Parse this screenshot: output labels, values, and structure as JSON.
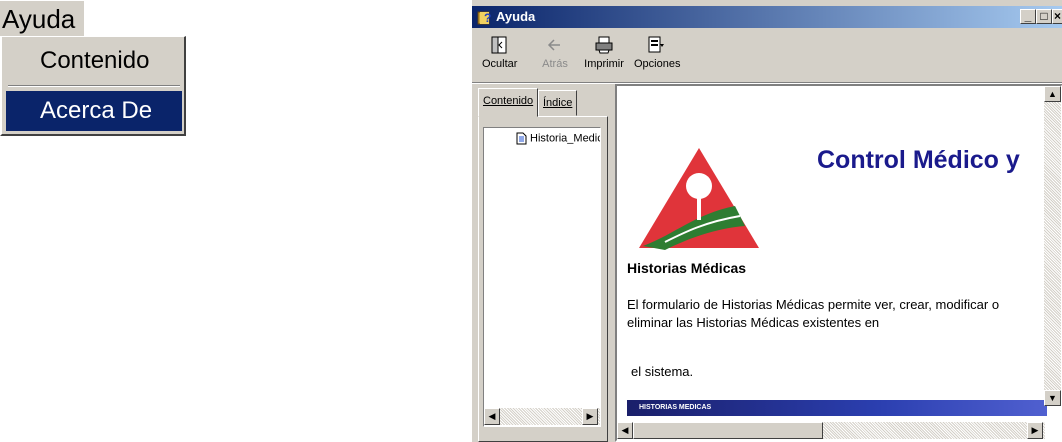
{
  "menu": {
    "title": "Ayuda",
    "items": [
      {
        "label": "Contenido",
        "selected": false
      },
      {
        "label": "Acerca De",
        "selected": true
      }
    ],
    "selection_color": "#0a246a"
  },
  "window": {
    "title": "Ayuda",
    "title_icon": "help-book-icon",
    "caption_buttons": [
      "minimize",
      "maximize",
      "close"
    ],
    "toolbar": [
      {
        "label": "Ocultar",
        "icon": "hide-pane-icon",
        "enabled": true
      },
      {
        "label": "Atrás",
        "icon": "back-arrow-icon",
        "enabled": false
      },
      {
        "label": "Imprimir",
        "icon": "printer-icon",
        "enabled": true
      },
      {
        "label": "Opciones",
        "icon": "options-icon",
        "enabled": true
      }
    ],
    "nav": {
      "tabs": [
        {
          "label": "Contenido",
          "active": true
        },
        {
          "label": "Índice",
          "active": false
        }
      ],
      "tree_items": [
        {
          "label": "Historia_Medica",
          "icon": "document-icon"
        }
      ]
    },
    "content": {
      "heading": "Control Médico y",
      "section_title": "Historias Médicas",
      "paragraph": "El formulario de Historias Médicas permite ver, crear, modificar o eliminar las Historias Médicas existentes en",
      "paragraph_cont": "el sistema.",
      "banner_text": "HISTORIAS MEDICAS",
      "heading_color": "#1a1a8c"
    }
  }
}
